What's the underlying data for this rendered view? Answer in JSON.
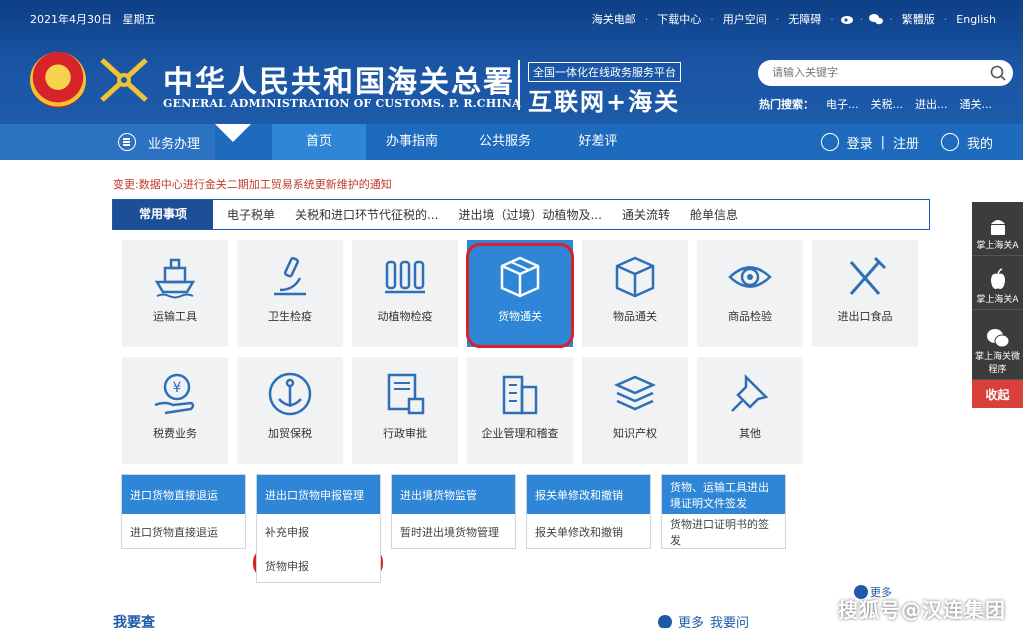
{
  "header": {
    "date": "2021年4月30日",
    "weekday": "星期五",
    "links": [
      "海关电邮",
      "下载中心",
      "用户空间",
      "无障碍",
      "繁體版",
      "English"
    ],
    "title_cn": "中华人民共和国海关总署",
    "title_en": "GENERAL ADMINISTRATION OF CUSTOMS. P. R.CHINA",
    "platform_label": "全国一体化在线政务服务平台",
    "platform_big": "互联网+海关",
    "search_placeholder": "请输入关键字",
    "hot_label": "热门搜索：",
    "hot_items": [
      "电子...",
      "关税...",
      "进出...",
      "通关..."
    ]
  },
  "nav": {
    "biz": "业务办理",
    "items": [
      "首页",
      "办事指南",
      "公共服务",
      "好差评"
    ],
    "login": "登录",
    "register": "注册",
    "mine": "我的",
    "divider": "|"
  },
  "notice": "变更:数据中心进行金关二期加工贸易系统更新维护的通知",
  "tabs": [
    "常用事项",
    "电子税单",
    "关税和进口环节代征税的...",
    "进出境（过境）动植物及...",
    "通关流转",
    "舱单信息"
  ],
  "grid": {
    "row1": [
      "运输工具",
      "卫生检疫",
      "动植物检疫",
      "货物通关",
      "物品通关",
      "商品检验",
      "进出口食品"
    ],
    "row2": [
      "税费业务",
      "加贸保税",
      "行政审批",
      "企业管理和稽查",
      "知识产权",
      "其他"
    ]
  },
  "cards": [
    {
      "title": "进口货物直接退运",
      "items": [
        "进口货物直接退运"
      ]
    },
    {
      "title": "进出口货物申报管理",
      "items": [
        "补充申报",
        "货物申报"
      ]
    },
    {
      "title": "进出境货物监管",
      "items": [
        "暂时进出境货物管理"
      ]
    },
    {
      "title": "报关单修改和撤销",
      "items": [
        "报关单修改和撤销"
      ]
    },
    {
      "title": "货物、运输工具进出境证明文件签发",
      "items": [
        "货物进口证明书的签发"
      ]
    }
  ],
  "bottom": {
    "left": "我要查",
    "more1": "更多",
    "more2": "更多",
    "ask": "我要问"
  },
  "side": {
    "android": "掌上海关A",
    "ios": "掌上海关A",
    "wechat": "掌上海关微程序",
    "collapse": "收起"
  },
  "watermark": "搜狐号@汉连集团",
  "colors": {
    "header_bg": "#1b56a6",
    "nav_bg": "#1e6bbd",
    "accent": "#2f86d6",
    "highlight_ring": "#d92127",
    "notice": "#c0392b"
  }
}
